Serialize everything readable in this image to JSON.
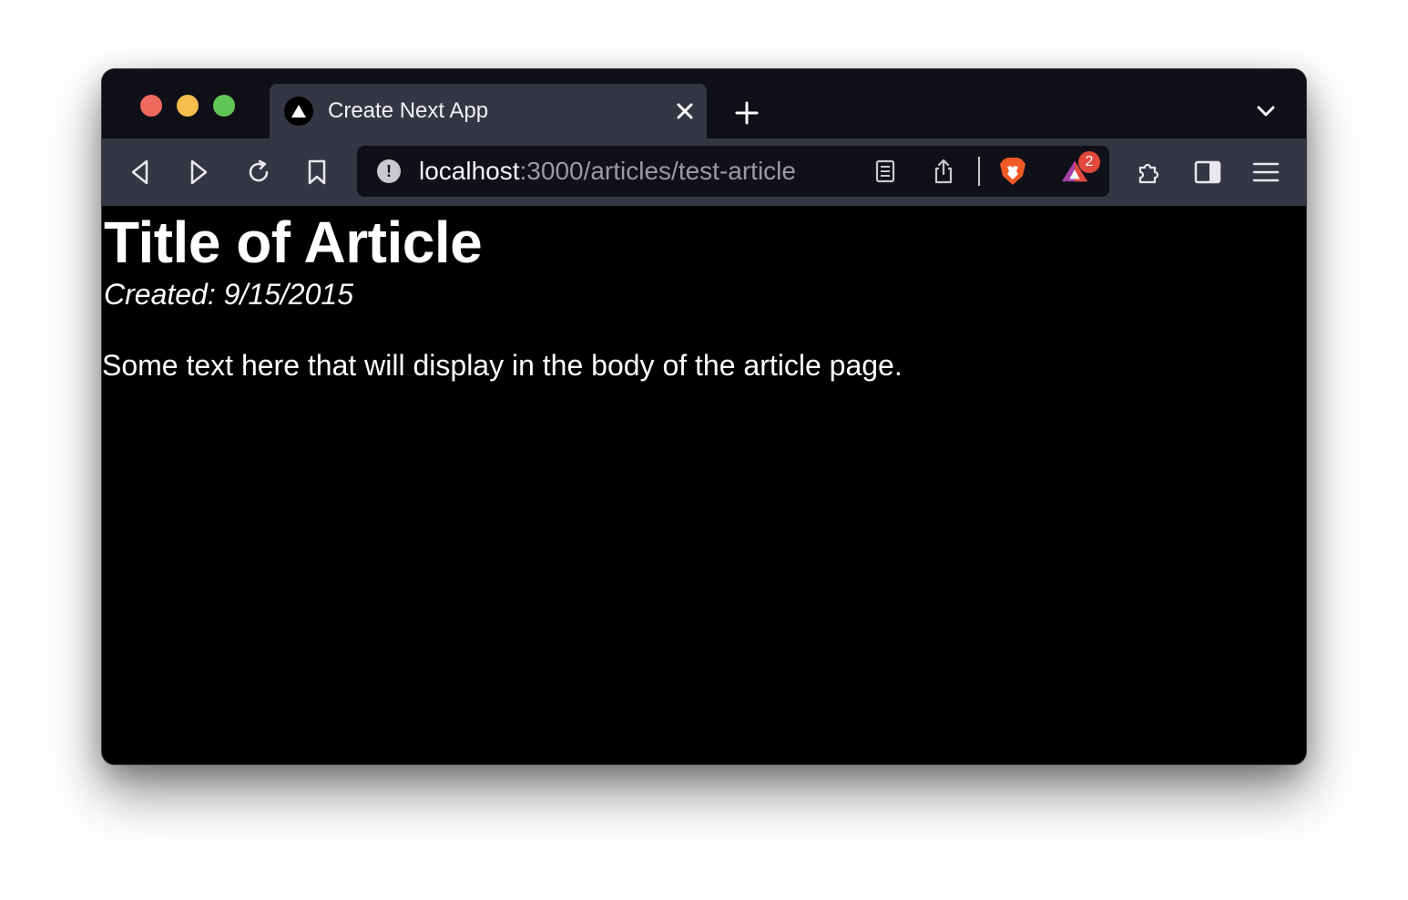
{
  "tab": {
    "title": "Create Next App",
    "favicon": "nextjs-triangle-icon"
  },
  "address_bar": {
    "host": "localhost",
    "rest": ":3000/articles/test-article"
  },
  "extensions": {
    "rewards_badge_count": "2"
  },
  "article": {
    "title": "Title of Article",
    "created": "Created: 9/15/2015",
    "body": "Some text here that will display in the body of the article page."
  },
  "colors": {
    "tabbar_bg": "#0f0f17",
    "toolbar_bg": "#343644",
    "urlbar_bg": "#101018",
    "brave_orange": "#f05a24",
    "page_bg": "#000000",
    "page_text": "#ffffff"
  }
}
